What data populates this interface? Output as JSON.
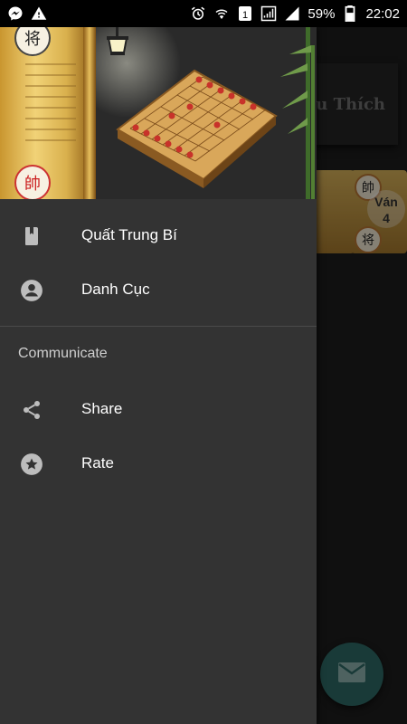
{
  "status_bar": {
    "battery_percent": "59%",
    "time": "22:02",
    "icons": [
      "messenger-icon",
      "warning-icon",
      "alarm-icon",
      "wifi-icon",
      "sim-1-icon",
      "signal-icon",
      "signal-icon",
      "battery-icon"
    ]
  },
  "drawer": {
    "header": {
      "top_piece_char": "将",
      "bottom_piece_char": "帥"
    },
    "items": [
      {
        "label": "Quất Trung Bí",
        "icon": "book-icon"
      },
      {
        "label": "Danh Cục",
        "icon": "account-circle-icon"
      }
    ],
    "section_title": "Communicate",
    "communicate_items": [
      {
        "label": "Share",
        "icon": "share-icon"
      },
      {
        "label": "Rate",
        "icon": "star-circle-icon"
      }
    ]
  },
  "background": {
    "header_title_partial": "u Thích",
    "tile_piece_top": "帥",
    "tile_piece_bottom": "将",
    "tile_label_line1": "Ván",
    "tile_label_line2": "4",
    "fab_icon": "mail-icon"
  },
  "colors": {
    "drawer_bg": "#333333",
    "fab_bg": "#2f6a66"
  }
}
